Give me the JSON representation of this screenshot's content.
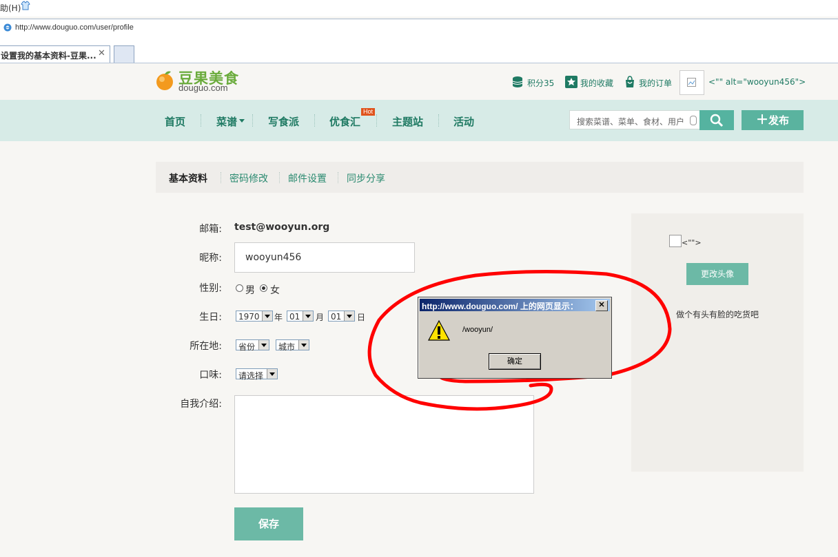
{
  "browser": {
    "menu_fragment": "助(H)",
    "address": "http://www.douguo.com/user/profile",
    "tab_title": "设置我的基本资料-豆果...",
    "tab_close": "✕"
  },
  "header": {
    "logo_cn": "豆果美食",
    "logo_en": "douguo.com",
    "points": "积分35",
    "favorites": "我的收藏",
    "orders": "我的订单",
    "avatar_alt_text": "<\"\" alt=\"wooyun456\">"
  },
  "nav": {
    "items": [
      "首页",
      "菜谱",
      "写食派",
      "优食汇",
      "主题站",
      "活动"
    ],
    "hot_badge": "Hot",
    "search_placeholder": "搜索菜谱、菜单、食材、用户",
    "publish": "发布"
  },
  "profile_tabs": [
    "基本资料",
    "密码修改",
    "邮件设置",
    "同步分享"
  ],
  "form": {
    "email_label": "邮箱:",
    "email_value": "test@wooyun.org",
    "nickname_label": "昵称:",
    "nickname_value": "wooyun456",
    "gender_label": "性别:",
    "gender_options": [
      "男",
      "女"
    ],
    "gender_selected": "女",
    "birthday_label": "生日:",
    "birth_year": "1970",
    "year_unit": "年",
    "birth_month": "01",
    "month_unit": "月",
    "birth_day": "01",
    "day_unit": "日",
    "location_label": "所在地:",
    "province": "省份",
    "city": "城市",
    "taste_label": "口味:",
    "taste_value": "请选择",
    "bio_label": "自我介绍:",
    "save": "保存"
  },
  "side": {
    "broken_alt": "<\"\">",
    "change_avatar": "更改头像",
    "slogan": "做个有头有脸的吃货吧"
  },
  "dialog": {
    "title": "http://www.douguo.com/ 上的网页显示：",
    "message": "/wooyun/",
    "ok": "确定"
  },
  "colors": {
    "accent": "#1f7a63",
    "nav_bg": "#d7ebe7",
    "button": "#6cb9a6",
    "annotation": "#ff0000"
  }
}
